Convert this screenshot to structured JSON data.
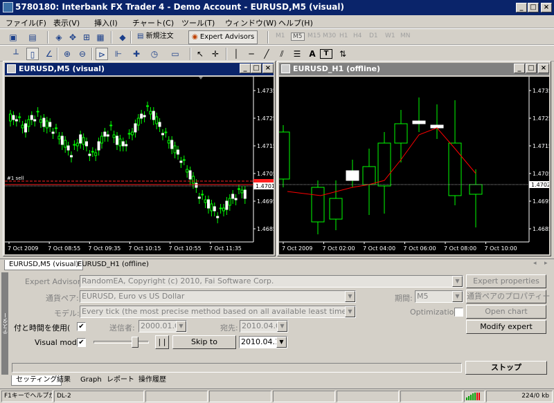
{
  "window": {
    "title": "5780180: Interbank FX Trader 4 - Demo Account - EURUSD,M5 (visual)"
  },
  "menu": [
    "ファイル(F)",
    "表示(V)",
    "挿入(I)",
    "チャート(C)",
    "ツール(T)",
    "ウィンドウ(W)",
    "ヘルプ(H)"
  ],
  "toolbar": {
    "new_order": "新規注文",
    "expert_advisors": "Expert Advisors",
    "timeframes": [
      "M1",
      "M5",
      "M15",
      "M30",
      "H1",
      "H4",
      "D1",
      "W1",
      "MN"
    ],
    "active_timeframe": "M5"
  },
  "charts": [
    {
      "title": "EURUSD,M5 (visual)",
      "price_labels": [
        "1.4735",
        "1.4725",
        "1.4715",
        "1.4705",
        "1.4695",
        "1.4685"
      ],
      "current_price": "1.4701",
      "order_label": "#1 sell",
      "time_labels": [
        "7 Oct 2009",
        "7 Oct 08:55",
        "7 Oct 09:35",
        "7 Oct 10:15",
        "7 Oct 10:55",
        "7 Oct 11:35"
      ]
    },
    {
      "title": "EURUSD_H1 (offline)",
      "price_labels": [
        "1.4735",
        "1.4725",
        "1.4715",
        "1.4705",
        "1.4695",
        "1.4685"
      ],
      "current_price": "1.4702",
      "time_labels": [
        "7 Oct 2009",
        "7 Oct 02:00",
        "7 Oct 04:00",
        "7 Oct 06:00",
        "7 Oct 08:00",
        "7 Oct 10:00"
      ]
    }
  ],
  "chart_tabs": [
    "EURUSD,M5 (visual)",
    "EURUSD_H1 (offline)"
  ],
  "tester": {
    "expert_label": "Expert Advisor:",
    "expert_value": "RandomEA, Copyright (c) 2010, Fai Software Corp.",
    "symbol_label": "通貨ペア:",
    "symbol_value": "EURUSD, Euro vs US Dollar",
    "period_label": "期間:",
    "period_value": "M5",
    "model_label": "モデル:",
    "model_value": "Every tick (the most precise method based on all available least timeframes",
    "optimization_label": "Optimization",
    "use_date_label": "付と時間を使用(",
    "from_label": "送信者:",
    "from_value": "2000.01.01",
    "to_label": "宛先:",
    "to_value": "2010.04.0",
    "visual_mode_label": "Visual mode",
    "pause_label": "| |",
    "skip_to_label": "Skip to",
    "skip_to_value": "2010.04.1(",
    "expert_properties": "Expert properties",
    "symbol_properties": "通貨ペアのプロパティー",
    "open_chart": "Open chart",
    "modify_expert": "Modify expert",
    "stop": "ストップ",
    "side_label": "テスター"
  },
  "bottom_tabs": [
    "セッティング",
    "結果",
    "Graph",
    "レポート",
    "操作履歴"
  ],
  "status": {
    "help": "F1キーでヘルプが表示",
    "profile": "DL-2",
    "traffic": "224/0 kb"
  },
  "colors": {
    "bull": "#00ff00",
    "bear": "#000000",
    "ma": "#ff0000",
    "ask_line": "#ff0000",
    "title_active": "#0a246a",
    "title_inactive": "#808080"
  }
}
